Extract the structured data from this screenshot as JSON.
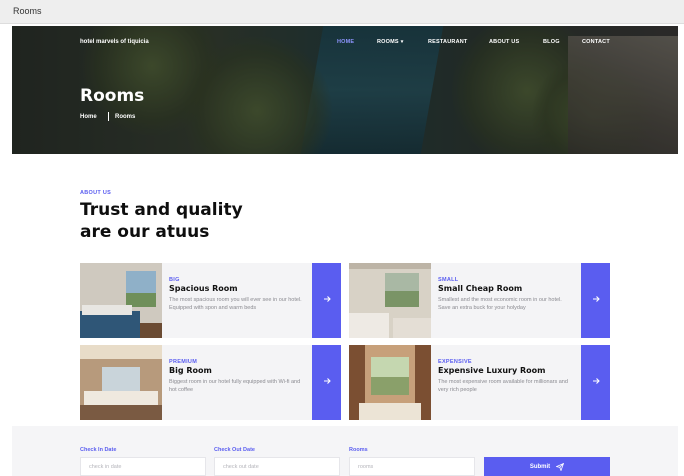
{
  "window": {
    "title": "Rooms"
  },
  "header": {
    "brand": "hotel marvels of tiquicia",
    "nav": [
      {
        "label": "HOME",
        "active": true
      },
      {
        "label": "ROOMS",
        "has_dropdown": true
      },
      {
        "label": "RESTAURANT"
      },
      {
        "label": "ABOUT US"
      },
      {
        "label": "BLOG"
      },
      {
        "label": "CONTACT"
      }
    ]
  },
  "hero": {
    "title": "Rooms",
    "breadcrumb": [
      "Home",
      "Rooms"
    ]
  },
  "about": {
    "eyebrow": "ABOUT US",
    "heading_line1": "Trust and quality",
    "heading_line2": "are our atuus"
  },
  "rooms": [
    {
      "tag": "BIG",
      "title": "Spacious Room",
      "desc": "The most spacious room you will ever see in our hotel. Equipped with spon and warm beds"
    },
    {
      "tag": "SMALL",
      "title": "Small Cheap Room",
      "desc": "Smallest and the most economic room in our hotel. Save an extra buck for your holyday"
    },
    {
      "tag": "PREMIUM",
      "title": "Big Room",
      "desc": "Biggest room in our hotel fully equipped with Wi-fi and hot coffee"
    },
    {
      "tag": "EXPENSIVE",
      "title": "Expensive Luxury Room",
      "desc": "The most expensive room available for millionars and very rich people"
    }
  ],
  "booking": {
    "check_in_label": "Check In Date",
    "check_in_placeholder": "check in date",
    "check_out_label": "Check Out Date",
    "check_out_placeholder": "check out date",
    "rooms_label": "Rooms",
    "rooms_placeholder": "rooms",
    "submit_label": "Submit",
    "submit_icon": "paper-plane-icon"
  },
  "colors": {
    "accent": "#5a5df0",
    "card_bg": "#f4f4f6",
    "muted_text": "#8a8a90"
  }
}
